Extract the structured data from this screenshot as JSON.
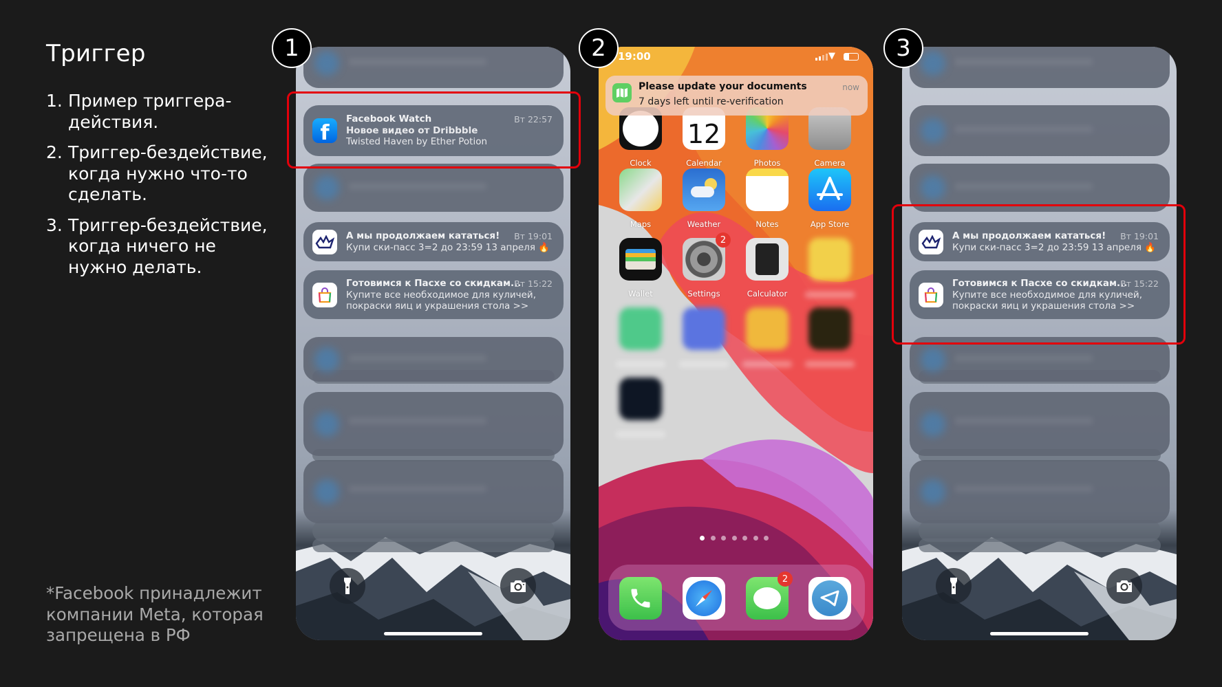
{
  "slide": {
    "title": "Триггер",
    "items": [
      {
        "num": "1.",
        "text": "Пример триггера-действия."
      },
      {
        "num": "2.",
        "text": "Триггер-бездействие, когда нужно что-то сделать."
      },
      {
        "num": "3.",
        "text": "Триггер-бездействие, когда ничего не нужно делать."
      }
    ],
    "footnote": "*Facebook принадлежит компании Meta, которая запрещена в РФ",
    "step_labels": [
      "1",
      "2",
      "3"
    ],
    "highlight_color": "#e3000b"
  },
  "lock1": {
    "notifications": [
      {
        "kind": "blur"
      },
      {
        "kind": "app",
        "icon": "facebook-icon",
        "title": "Facebook Watch",
        "time": "Вт 22:57",
        "lines": [
          "Новое видео от Dribbble",
          "Twisted Haven by Ether Potion"
        ],
        "bold2": true
      },
      {
        "kind": "blur"
      },
      {
        "kind": "app",
        "icon": "ski-resort-icon",
        "title": "А мы продолжаем кататься!",
        "time": "Вт 19:01",
        "lines": [
          "Купи ски-пасс 3=2 до 23:59 13 апреля 🔥"
        ]
      },
      {
        "kind": "app",
        "icon": "shopping-bag-icon",
        "title": "Готовимся к Пасхе со скидкам...",
        "time": "Вт 15:22",
        "lines": [
          "Купите все необходимое для куличей,",
          "покраски яиц и украшения стола >>"
        ]
      },
      {
        "kind": "blur"
      },
      {
        "kind": "blur"
      },
      {
        "kind": "blur"
      }
    ]
  },
  "lock3": {
    "notifications": [
      {
        "kind": "blur"
      },
      {
        "kind": "blur"
      },
      {
        "kind": "blur"
      },
      {
        "kind": "app",
        "icon": "ski-resort-icon",
        "title": "А мы продолжаем кататься!",
        "time": "Вт 19:01",
        "lines": [
          "Купи ски-пасс 3=2 до 23:59 13 апреля 🔥"
        ]
      },
      {
        "kind": "app",
        "icon": "shopping-bag-icon",
        "title": "Готовимся к Пасхе со скидкам...",
        "time": "Вт 15:22",
        "lines": [
          "Купите все необходимое для куличей,",
          "покраски яиц и украшения стола >>"
        ]
      },
      {
        "kind": "blur"
      },
      {
        "kind": "blur"
      },
      {
        "kind": "blur"
      }
    ]
  },
  "home": {
    "status_time": "19:00",
    "banner": {
      "title": "Please update your documents",
      "body": "7 days left until re-verification",
      "time": "now",
      "icon": "map-app-icon"
    },
    "apps": [
      {
        "label": "Clock",
        "icon": "clock-icon"
      },
      {
        "label": "Calendar",
        "icon": "calendar-icon",
        "glyph": "12"
      },
      {
        "label": "Photos",
        "icon": "photos-icon"
      },
      {
        "label": "Camera",
        "icon": "camera-app-icon"
      },
      {
        "label": "Maps",
        "icon": "maps-icon"
      },
      {
        "label": "Weather",
        "icon": "weather-icon"
      },
      {
        "label": "Notes",
        "icon": "notes-icon"
      },
      {
        "label": "App Store",
        "icon": "app-store-icon"
      },
      {
        "label": "Wallet",
        "icon": "wallet-icon"
      },
      {
        "label": "Settings",
        "icon": "settings-icon",
        "badge": "2"
      },
      {
        "label": "Calculator",
        "icon": "calculator-icon"
      },
      {
        "blurred": true,
        "icon": "blurred-app-icon",
        "color": "#f2d04a"
      },
      {
        "blurred": true,
        "icon": "blurred-app-icon",
        "color": "#4fc98a"
      },
      {
        "blurred": true,
        "icon": "blurred-app-icon",
        "color": "#5b74e0"
      },
      {
        "blurred": true,
        "icon": "blurred-app-icon",
        "color": "#f0b83c"
      },
      {
        "blurred": true,
        "icon": "blurred-app-icon",
        "color": "#2a2410"
      },
      {
        "blurred": true,
        "icon": "blurred-app-icon",
        "color": "#0e1624"
      }
    ],
    "page_count": 7,
    "current_page": 1,
    "dock": [
      {
        "icon": "phone-icon"
      },
      {
        "icon": "safari-icon"
      },
      {
        "icon": "messages-icon",
        "badge": "2"
      },
      {
        "icon": "telegram-icon"
      }
    ]
  }
}
